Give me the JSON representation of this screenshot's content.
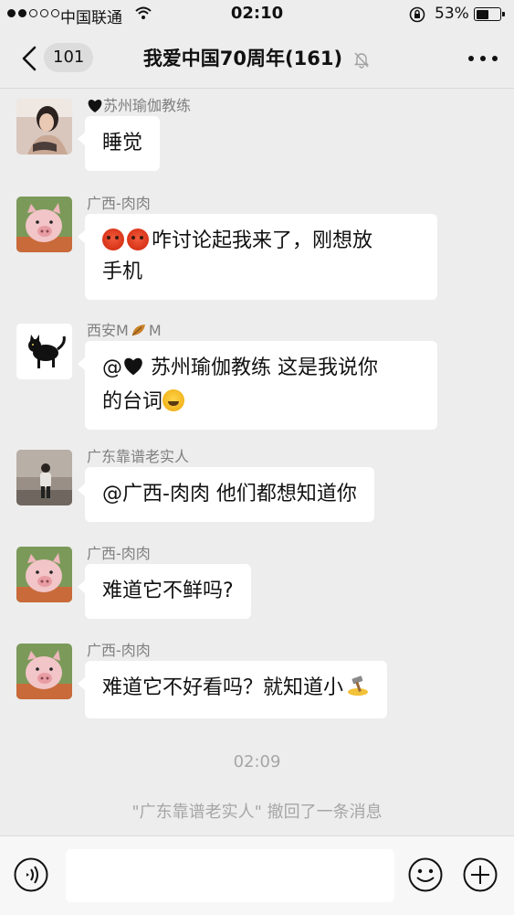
{
  "status_bar": {
    "carrier": "中国联通",
    "time": "02:10",
    "battery": "53%",
    "battery_level": 0.53,
    "signal_bars": 2
  },
  "nav": {
    "unread_count": "101",
    "title": "我爱中国70周年(161)",
    "icons": [
      "back-chevron-icon",
      "mute-bell-icon",
      "more-icon"
    ]
  },
  "messages": [
    {
      "sender": "苏州瑜伽教练",
      "sender_prefix_icon": "black-heart-icon",
      "text": "睡觉",
      "avatar": "avatar-woman-photo"
    },
    {
      "sender": "广西-肉肉",
      "text": "咋讨论起我来了，刚想放手机",
      "text_line1": "咋讨论起我来了，刚想放",
      "text_line2": "手机",
      "lead_emojis": [
        "flushed-face-emoji",
        "flushed-face-emoji"
      ],
      "avatar": "avatar-pig"
    },
    {
      "sender": "西安M",
      "sender_suffix": "M",
      "sender_mid_icon": "leaf-emoji",
      "text_line1_a": "@",
      "text_line1_b": " 苏州瑜伽教练 这是我说你",
      "text_line2": "的台词",
      "trail_emoji": "laughing-emoji",
      "avatar": "avatar-black-cat"
    },
    {
      "sender": "广东靠谱老实人",
      "text": "@广西-肉肉 他们都想知道你",
      "avatar": "avatar-person-walking"
    },
    {
      "sender": "广西-肉肉",
      "text": "难道它不鲜吗?",
      "avatar": "avatar-pig"
    },
    {
      "sender": "广西-肉肉",
      "text": "难道它不好看吗？就知道小",
      "trail_emoji": "hammer-emoji",
      "avatar": "avatar-pig"
    }
  ],
  "time_divider": "02:09",
  "recall_notice": "\"广东靠谱老实人\" 撤回了一条消息",
  "input_bar": {
    "placeholder": "",
    "icons": [
      "voice-icon",
      "emoji-face-icon",
      "plus-icon"
    ]
  },
  "colors": {
    "background": "#ededed",
    "bubble": "#ffffff",
    "meta_text": "#a6a6a6",
    "sender_text": "#7f7f7f"
  }
}
